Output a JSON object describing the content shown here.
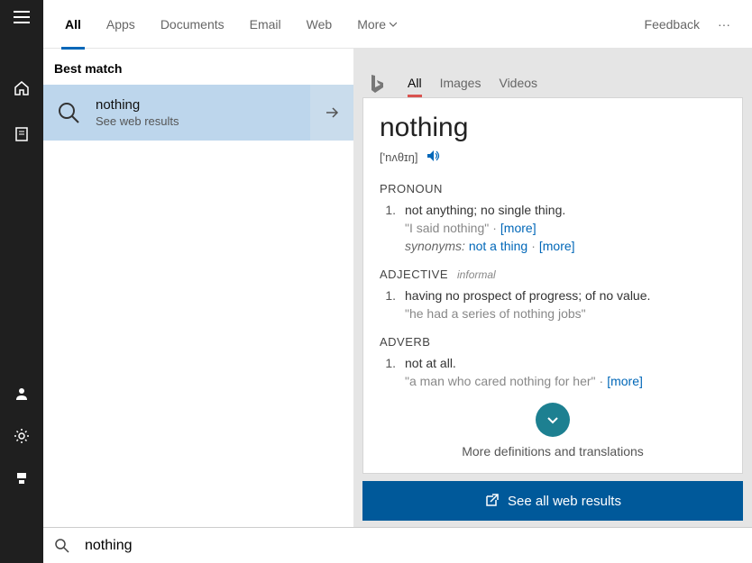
{
  "tabs": [
    "All",
    "Apps",
    "Documents",
    "Email",
    "Web",
    "More"
  ],
  "feedback": "Feedback",
  "best_match_label": "Best match",
  "match": {
    "title": "nothing",
    "subtitle": "See web results"
  },
  "preview_tabs": [
    "All",
    "Images",
    "Videos"
  ],
  "dict": {
    "word": "nothing",
    "pron": "['nʌθɪŋ]",
    "pronoun_label": "PRONOUN",
    "pronoun_def": "not anything; no single thing.",
    "pronoun_example": "\"I said nothing\"",
    "synonyms_label": "synonyms:",
    "synonym": "not a thing",
    "adjective_label": "ADJECTIVE",
    "informal_label": "informal",
    "adjective_def": "having no prospect of progress; of no value.",
    "adjective_example": "\"he had a series of nothing jobs\"",
    "adverb_label": "ADVERB",
    "adverb_def": "not at all.",
    "adverb_example": "\"a man who cared nothing for her\"",
    "more": "[more]",
    "expand_label": "More definitions and translations"
  },
  "see_all": "See all web results",
  "search_value": "nothing"
}
